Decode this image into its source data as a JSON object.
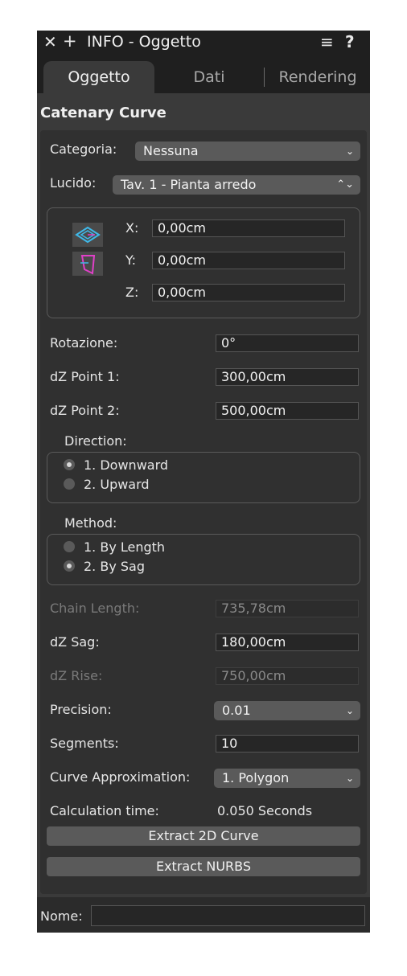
{
  "titlebar": {
    "close": "✕",
    "add": "+",
    "title": "INFO - Oggetto",
    "menu": "≡",
    "help": "?"
  },
  "tabs": [
    {
      "label": "Oggetto",
      "active": true
    },
    {
      "label": "Dati",
      "active": false
    },
    {
      "label": "Rendering",
      "active": false
    }
  ],
  "object_title": "Catenary Curve",
  "categoria": {
    "label": "Categoria:",
    "value": "Nessuna"
  },
  "lucido": {
    "label": "Lucido:",
    "value": "Tav. 1 - Pianta arredo"
  },
  "coords": {
    "x_label": "X:",
    "x": "0,00cm",
    "y_label": "Y:",
    "y": "0,00cm",
    "z_label": "Z:",
    "z": "0,00cm"
  },
  "params": {
    "rotazione": {
      "label": "Rotazione:",
      "value": "0°"
    },
    "dz1": {
      "label": "dZ Point 1:",
      "value": "300,00cm"
    },
    "dz2": {
      "label": "dZ Point 2:",
      "value": "500,00cm"
    }
  },
  "direction": {
    "label": "Direction:",
    "options": [
      "1. Downward",
      "2. Upward"
    ],
    "selected": 0
  },
  "method": {
    "label": "Method:",
    "options": [
      "1. By Length",
      "2. By Sag"
    ],
    "selected": 1
  },
  "chain_length": {
    "label": "Chain Length:",
    "value": "735,78cm"
  },
  "dz_sag": {
    "label": "dZ Sag:",
    "value": "180,00cm"
  },
  "dz_rise": {
    "label": "dZ Rise:",
    "value": "750,00cm"
  },
  "precision": {
    "label": "Precision:",
    "value": "0.01"
  },
  "segments": {
    "label": "Segments:",
    "value": "10"
  },
  "curve_approx": {
    "label": "Curve Approximation:",
    "value": "1. Polygon"
  },
  "calc_time": {
    "label": "Calculation time:",
    "value": "0.050 Seconds"
  },
  "buttons": {
    "extract2d": "Extract 2D Curve",
    "nurbs": "Extract NURBS"
  },
  "name": {
    "label": "Nome:",
    "value": ""
  },
  "colors": {
    "panel": "#2b2b2b",
    "content": "#3a3a3a",
    "popup": "#5a5a5a",
    "icon_cyan": "#3fb8e8",
    "icon_magenta": "#e040c8"
  }
}
